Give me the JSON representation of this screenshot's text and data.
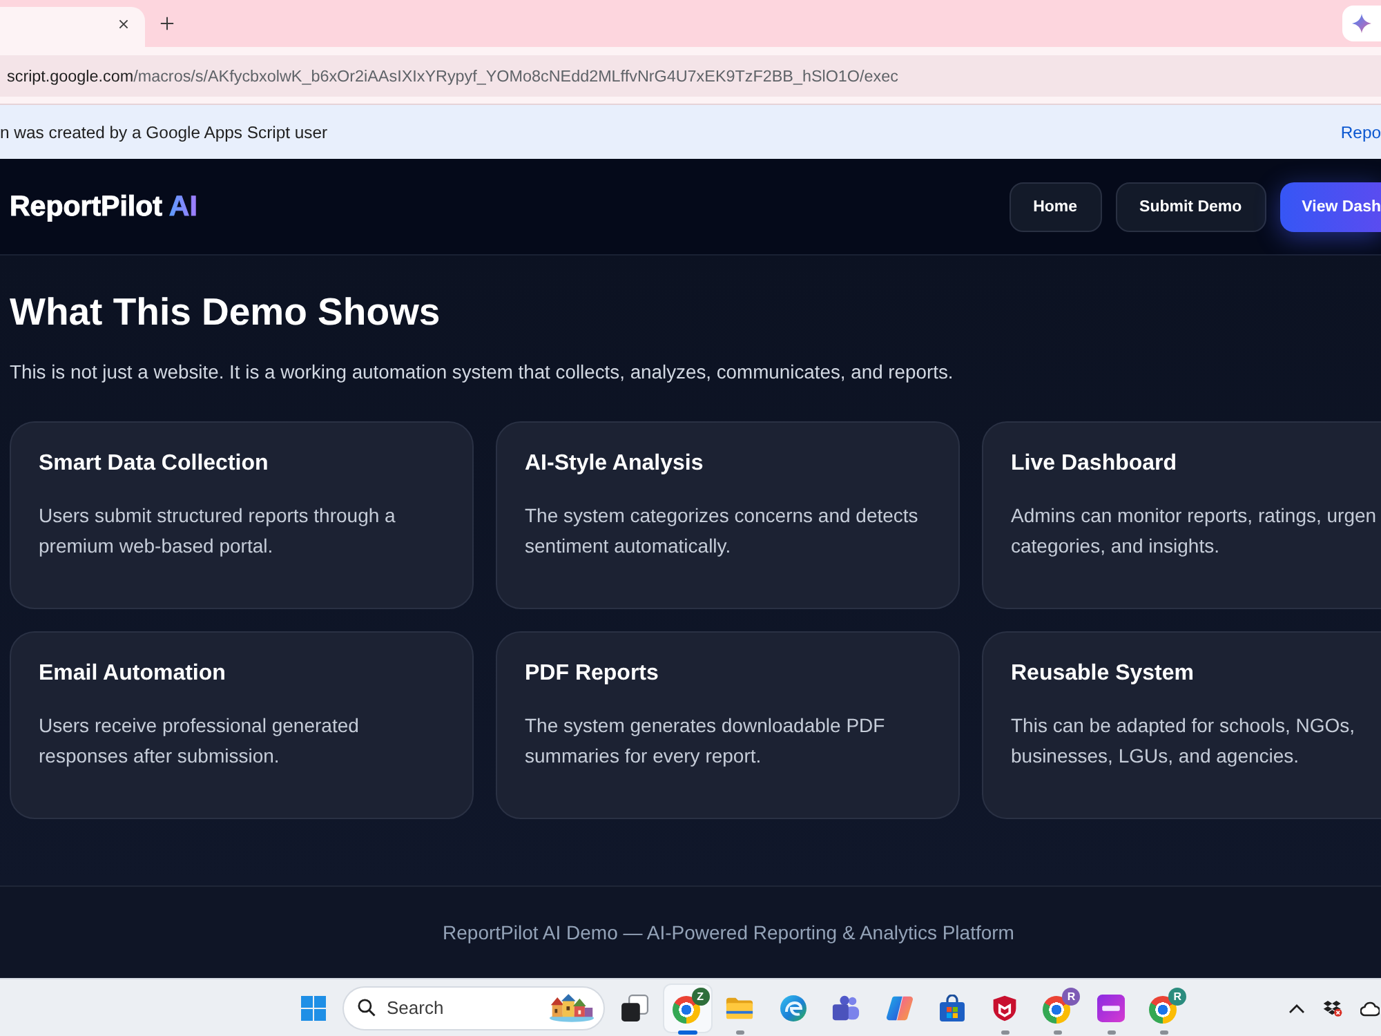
{
  "address_bar": {
    "host": "script.google.com",
    "path": "/macros/s/AKfycbxolwK_b6xOr2iAAsIXIxYRypyf_YOMo8cNEdd2MLffvNrG4U7xEK9TzF2BB_hSlO1O/exec"
  },
  "info_bar": {
    "message": "n was created by a Google Apps Script user",
    "link": "Repo"
  },
  "header": {
    "brand": {
      "name": "ReportPilot",
      "accent": "AI"
    },
    "nav": [
      {
        "label": "Home",
        "kind": "outline"
      },
      {
        "label": "Submit Demo",
        "kind": "outline"
      },
      {
        "label": "View Dash",
        "kind": "primary"
      }
    ]
  },
  "hero": {
    "title": "What This Demo Shows",
    "subtitle": "This is not just a website. It is a working automation system that collects, analyzes, communicates, and reports."
  },
  "features": [
    {
      "title": "Smart Data Collection",
      "description": "Users submit structured reports through a premium web-based portal."
    },
    {
      "title": "AI-Style Analysis",
      "description": "The system categorizes concerns and detects sentiment automatically."
    },
    {
      "title": "Live Dashboard",
      "description": "Admins can monitor reports, ratings, urgen categories, and insights."
    },
    {
      "title": "Email Automation",
      "description": "Users receive professional generated responses after submission."
    },
    {
      "title": "PDF Reports",
      "description": "The system generates downloadable PDF summaries for every report."
    },
    {
      "title": "Reusable System",
      "description": "This can be adapted for schools, NGOs, businesses, LGUs, and agencies."
    }
  ],
  "footer": {
    "text": "ReportPilot AI Demo — AI-Powered Reporting & Analytics Platform"
  },
  "taskbar": {
    "search": {
      "placeholder": "Search"
    },
    "apps": [
      {
        "kind": "task_view",
        "running": false,
        "selected": false
      },
      {
        "kind": "chrome",
        "badge": {
          "text": "Z",
          "color": "#2e6e3b"
        },
        "running": true,
        "selected": true
      },
      {
        "kind": "files",
        "running": true,
        "selected": false
      },
      {
        "kind": "edge",
        "running": false,
        "selected": false
      },
      {
        "kind": "teams",
        "running": false,
        "selected": false
      },
      {
        "kind": "copilot",
        "running": false,
        "selected": false
      },
      {
        "kind": "store",
        "running": false,
        "selected": false
      },
      {
        "kind": "mcafee",
        "running": true,
        "selected": false
      },
      {
        "kind": "chrome",
        "badge": {
          "text": "R",
          "color": "#7d5bb5"
        },
        "running": true,
        "selected": false
      },
      {
        "kind": "app",
        "running": true,
        "selected": false
      },
      {
        "kind": "chrome",
        "badge": {
          "text": "R",
          "color": "#2b8c7e"
        },
        "running": true,
        "selected": false
      }
    ]
  }
}
